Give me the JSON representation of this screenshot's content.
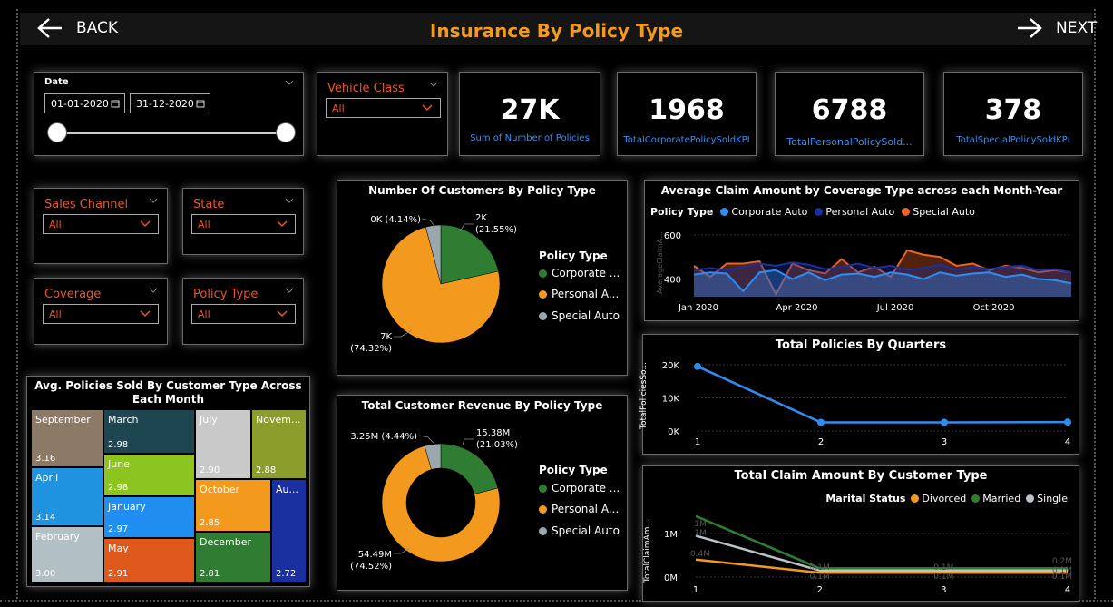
{
  "header": {
    "back_label": "BACK",
    "next_label": "NEXT",
    "title": "Insurance By Policy Type"
  },
  "filters": {
    "date": {
      "label": "Date",
      "start": "01-01-2020",
      "end": "31-12-2020"
    },
    "vehicle_class": {
      "label": "Vehicle Class",
      "value": "All"
    },
    "sales_channel": {
      "label": "Sales Channel",
      "value": "All"
    },
    "state": {
      "label": "State",
      "value": "All"
    },
    "coverage": {
      "label": "Coverage",
      "value": "All"
    },
    "policy_type": {
      "label": "Policy Type",
      "value": "All"
    }
  },
  "kpis": [
    {
      "value": "27K",
      "label": "Sum of Number of Policies"
    },
    {
      "value": "1968",
      "label": "TotalCorporatePolicySoldKPI"
    },
    {
      "value": "6788",
      "label": "TotalPersonalPolicySold..."
    },
    {
      "value": "378",
      "label": "TotalSpecialPolicySoldKPI"
    }
  ],
  "colors": {
    "corporate": "#2f7d32",
    "personal": "#f39a1e",
    "special": "#9aa7ad",
    "line_corporate": "#2f8cf0",
    "line_personal": "#1a2fa0",
    "line_special": "#e8642a",
    "divorced": "#f39a1e",
    "married": "#2f7d32",
    "single": "#b9c3c8",
    "accent": "#e8562a"
  },
  "chart_data": [
    {
      "id": "customers_pie",
      "type": "pie",
      "title": "Number Of Customers By Policy Type",
      "legend_title": "Policy Type",
      "legend": [
        "Corporate ...",
        "Personal A...",
        "Special Auto"
      ],
      "categories": [
        "Corporate Auto",
        "Personal Auto",
        "Special Auto"
      ],
      "values": [
        21.55,
        74.32,
        4.14
      ],
      "labels": [
        {
          "value": "2K",
          "pct": "(21.55%)"
        },
        {
          "value": "7K",
          "pct": "(74.32%)"
        },
        {
          "value": "0K (4.14%)",
          "pct": ""
        }
      ]
    },
    {
      "id": "revenue_donut",
      "type": "pie",
      "title": "Total Customer Revenue By Policy Type",
      "legend_title": "Policy Type",
      "legend": [
        "Corporate ...",
        "Personal A...",
        "Special Auto"
      ],
      "categories": [
        "Corporate Auto",
        "Personal Auto",
        "Special Auto"
      ],
      "values": [
        21.03,
        74.52,
        4.44
      ],
      "labels": [
        {
          "value": "15.38M",
          "pct": "(21.03%)"
        },
        {
          "value": "54.49M",
          "pct": "(74.52%)"
        },
        {
          "value": "3.25M (4.44%)",
          "pct": ""
        }
      ]
    },
    {
      "id": "avg_claim",
      "type": "area",
      "title": "Average Claim Amount by Coverage Type across each Month-Year",
      "legend_title": "Policy Type",
      "ylabel": "AverageClaimA...",
      "x_ticks": [
        "Jan 2020",
        "Apr 2020",
        "Jul 2020",
        "Oct 2020"
      ],
      "y_ticks": [
        "600",
        "400"
      ],
      "ylim": [
        320,
        620
      ],
      "series": [
        {
          "name": "Corporate Auto",
          "values": [
            420,
            430,
            425,
            345,
            430,
            440,
            400,
            430,
            395,
            420,
            425,
            410,
            430,
            420,
            400,
            430,
            415,
            425,
            430,
            410,
            420,
            400,
            395,
            380
          ]
        },
        {
          "name": "Personal Auto",
          "values": [
            440,
            450,
            440,
            455,
            470,
            460,
            475,
            465,
            445,
            455,
            470,
            450,
            460,
            440,
            450,
            465,
            440,
            455,
            445,
            455,
            460,
            440,
            445,
            430
          ]
        },
        {
          "name": "Special Auto",
          "values": [
            460,
            410,
            470,
            470,
            480,
            330,
            470,
            440,
            425,
            490,
            430,
            455,
            410,
            530,
            510,
            500,
            460,
            470,
            440,
            460,
            450,
            430,
            440,
            430
          ]
        }
      ]
    },
    {
      "id": "policies_quarters",
      "type": "line",
      "title": "Total Policies By Quarters",
      "ylabel": "TotalPoliciesSo...",
      "x": [
        "1",
        "2",
        "3",
        "4"
      ],
      "y_ticks": [
        "20K",
        "10K",
        "0K"
      ],
      "ylim": [
        0,
        20000
      ],
      "series": [
        {
          "values": [
            19500,
            2600,
            2600,
            2700
          ]
        }
      ]
    },
    {
      "id": "claim_customer_type",
      "type": "line",
      "title": "Total Claim Amount By Customer Type",
      "legend_title": "Marital Status",
      "ylabel": "TotalClaimAm...",
      "x": [
        "1",
        "2",
        "3",
        "4"
      ],
      "y_ticks": [
        "1M",
        "0M"
      ],
      "ylim": [
        0,
        1500000
      ],
      "series": [
        {
          "name": "Divorced",
          "values": [
            400000,
            100000,
            100000,
            100000
          ]
        },
        {
          "name": "Married",
          "values": [
            1400000,
            200000,
            200000,
            200000
          ]
        },
        {
          "name": "Single",
          "values": [
            950000,
            150000,
            150000,
            150000
          ]
        }
      ],
      "labels": {
        "q1": [
          "1M",
          "1M",
          "0.4M"
        ],
        "q2": [
          "0.1M",
          "0.1M"
        ],
        "q3": [
          "0.1M",
          "0.1M"
        ],
        "q4": [
          "0.2M",
          "0.1M",
          "0.1M"
        ]
      }
    },
    {
      "id": "treemap_month",
      "type": "heatmap",
      "title": "Avg. Policies Sold By Customer Type Across Each Month",
      "categories": [
        "September",
        "April",
        "February",
        "March",
        "June",
        "January",
        "May",
        "July",
        "October",
        "December",
        "Novem...",
        "Au..."
      ],
      "values": [
        "3.16",
        "3.14",
        "3.00",
        "2.98",
        "2.98",
        "2.97",
        "2.91",
        "2.90",
        "2.85",
        "2.81",
        "2.88",
        "2.72"
      ]
    }
  ]
}
